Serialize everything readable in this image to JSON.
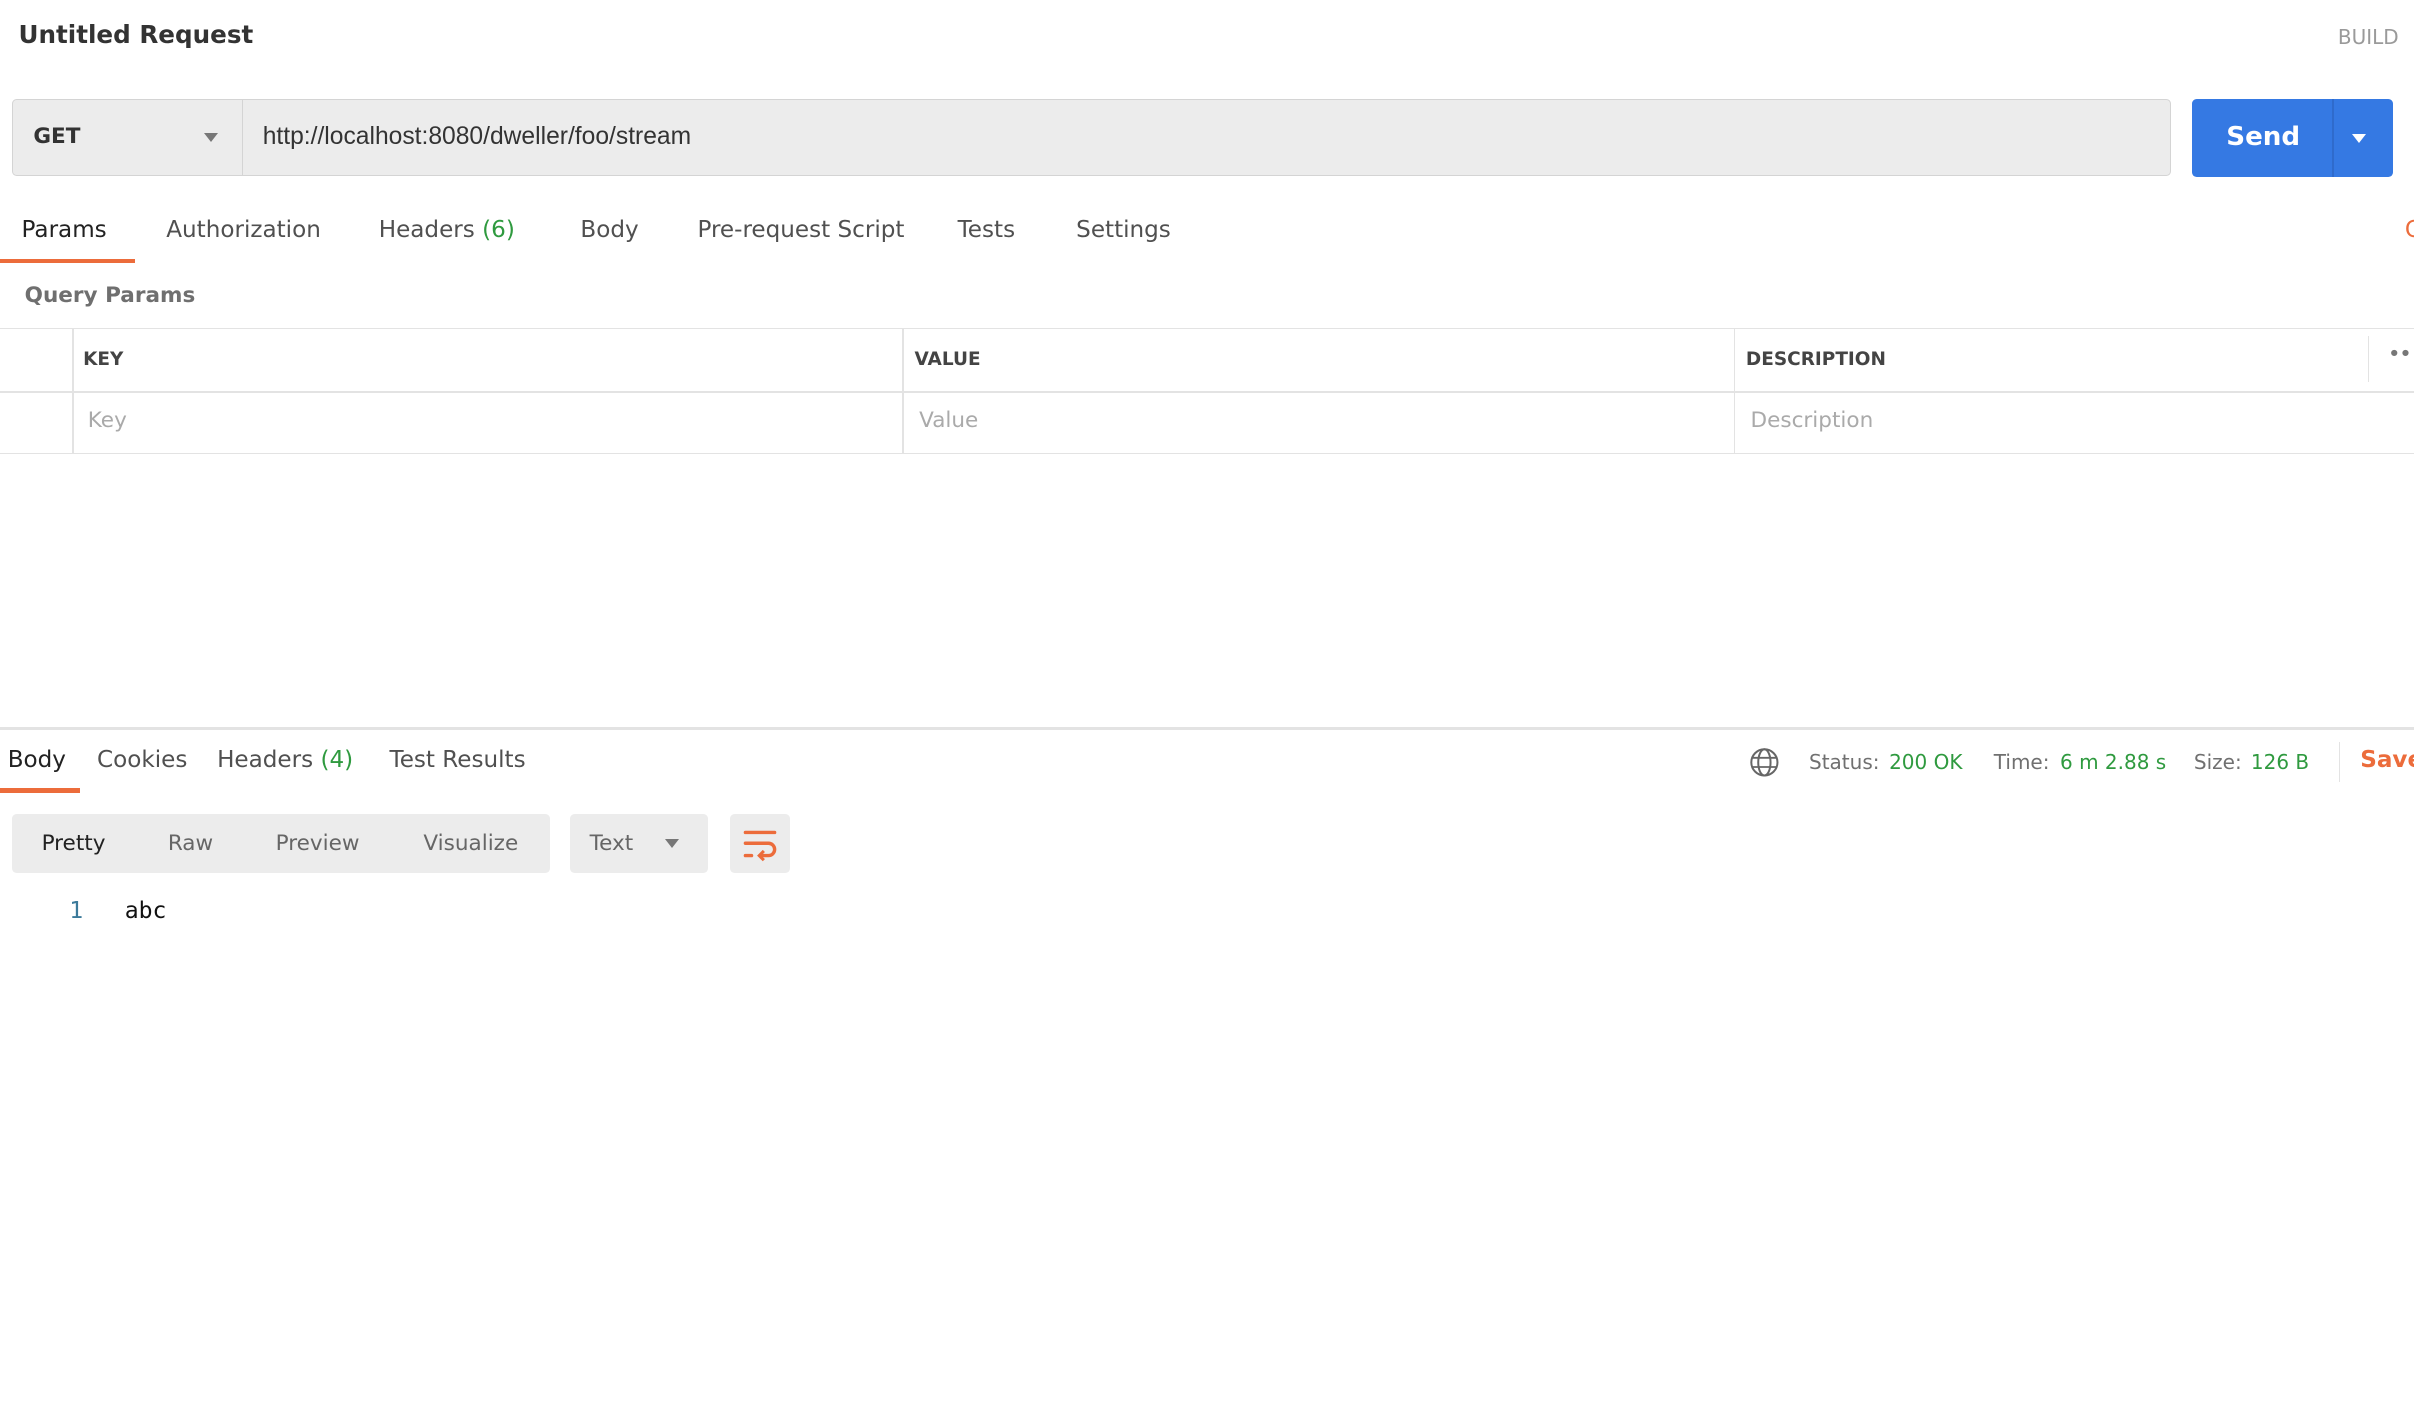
{
  "header": {
    "title": "Untitled Request",
    "mode": "BUILD"
  },
  "request": {
    "method": "GET",
    "url": "http://localhost:8080/dweller/foo/stream",
    "send_label": "Send"
  },
  "request_tabs": [
    {
      "label": "Params",
      "active": true
    },
    {
      "label": "Authorization"
    },
    {
      "label": "Headers",
      "count": "(6)"
    },
    {
      "label": "Body"
    },
    {
      "label": "Pre-request Script"
    },
    {
      "label": "Tests"
    },
    {
      "label": "Settings"
    }
  ],
  "cookies_link_partial": "C",
  "query_params": {
    "title": "Query Params",
    "columns": [
      "KEY",
      "VALUE",
      "DESCRIPTION"
    ],
    "placeholders": [
      "Key",
      "Value",
      "Description"
    ]
  },
  "response_tabs": [
    {
      "label": "Body",
      "active": true
    },
    {
      "label": "Cookies"
    },
    {
      "label": "Headers",
      "count": "(4)"
    },
    {
      "label": "Test Results"
    }
  ],
  "response_meta": {
    "status_label": "Status:",
    "status": "200 OK",
    "time_label": "Time:",
    "time": "6 m 2.88 s",
    "size_label": "Size:",
    "size": "126 B",
    "save_label": "Save"
  },
  "view_options": [
    "Pretty",
    "Raw",
    "Preview",
    "Visualize"
  ],
  "active_view": "Pretty",
  "format": "Text",
  "code_lines": [
    {
      "number": "1",
      "text": "abc"
    }
  ],
  "colors": {
    "accent": "#ec6c3b",
    "send": "#3579e3",
    "success": "#2f9a3f"
  }
}
